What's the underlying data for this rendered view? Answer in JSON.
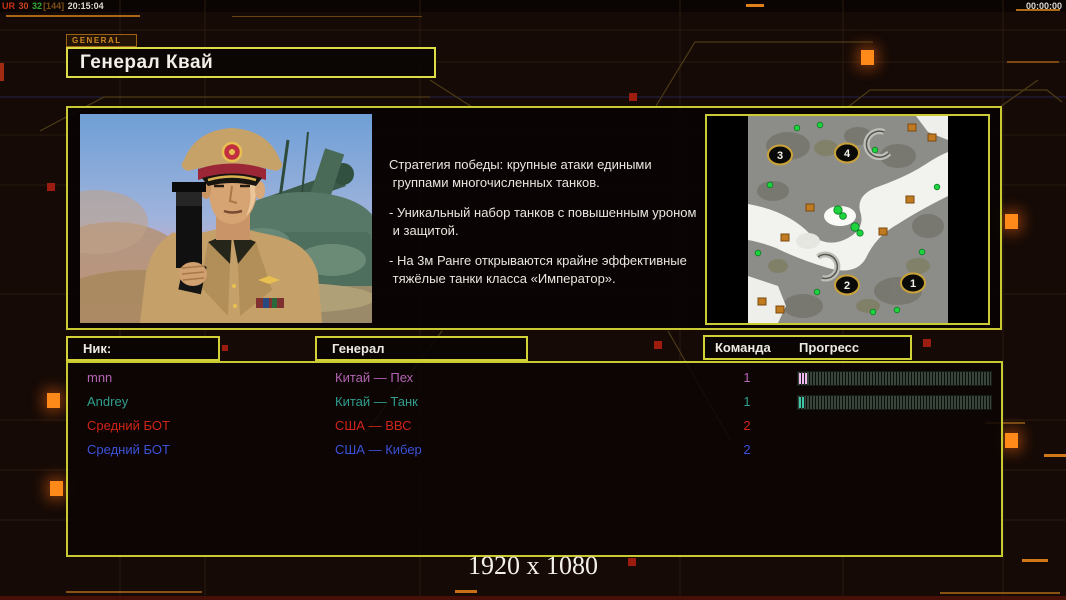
{
  "top_bar": {
    "net_stats": {
      "ur": "UR",
      "val1": "30",
      "val2": "32",
      "val3": "[144]",
      "clock": "20:15:04"
    },
    "match_timer": "00:00:00"
  },
  "tab": {
    "label": "GENERAL"
  },
  "title_box": {
    "title": "Генерал Квай"
  },
  "strategy": {
    "p1": "Стратегия победы: крупные атаки едиными\n группами многочисленных танков.",
    "p2": "- Уникальный набор танков с повышенным уроном\n и защитой.",
    "p3": "- На 3м Ранге открываются крайне эффективные\n тяжёлые танки класса «Император»."
  },
  "minimap": {
    "markers": [
      "3",
      "4",
      "2",
      "1"
    ]
  },
  "players_table": {
    "headers": {
      "nick": "Ник:",
      "general": "Генерал",
      "team": "Команда",
      "progress": "Прогресс"
    },
    "rows": [
      {
        "nick": "mnn",
        "general": "Китай — Пех",
        "team": "1",
        "color": "#b464b4",
        "progress": {
          "shown": true,
          "fill_color": "#efb9ef",
          "percent": 4
        }
      },
      {
        "nick": "Andrey",
        "general": "Китай — Танк",
        "team": "1",
        "color": "#2f9e8e",
        "progress": {
          "shown": true,
          "fill_color": "#3cc9a9",
          "percent": 3
        }
      },
      {
        "nick": "Средний БОТ",
        "general": "США — ВВС",
        "team": "2",
        "color": "#d02418",
        "progress": {
          "shown": false
        }
      },
      {
        "nick": "Средний БОТ",
        "general": "США — Кибер",
        "team": "2",
        "color": "#3b52d8",
        "progress": {
          "shown": false
        }
      }
    ]
  },
  "footer": {
    "resolution": "1920 x 1080"
  },
  "theme": {
    "panel_border": "#c9c932",
    "bright_border": "#dcdc46",
    "accent_orange": "#ff8a1a",
    "tab_text": "#cf8a1e",
    "map_marker_ring": "#c9a23a",
    "map_tree_green": "#1ed43e",
    "map_building_orange": "#c07a20"
  }
}
